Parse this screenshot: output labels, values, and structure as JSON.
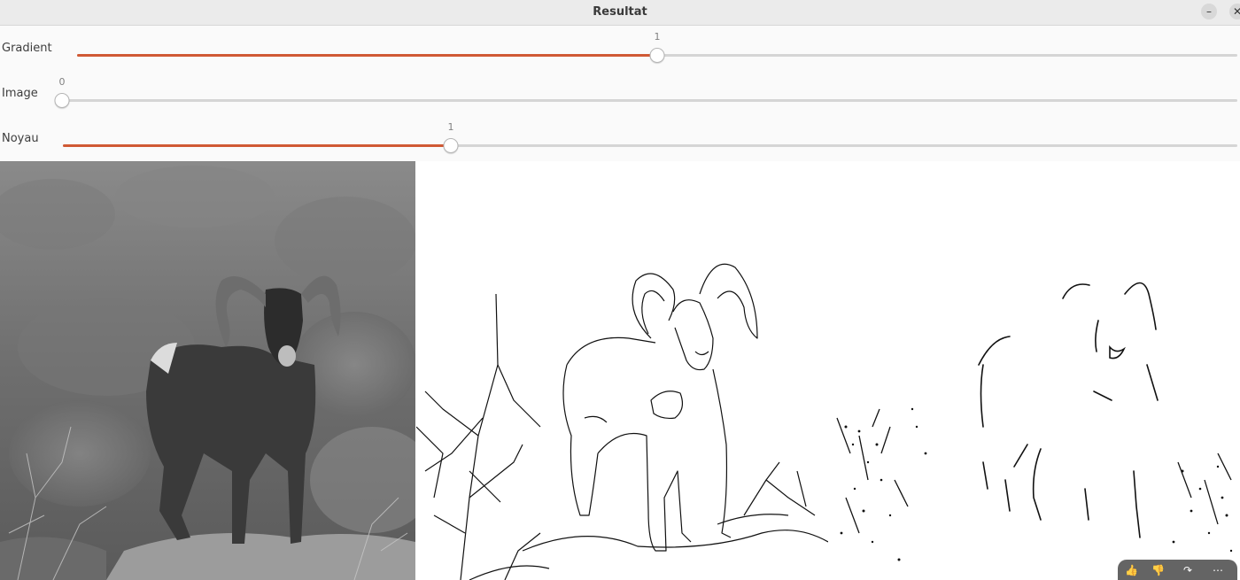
{
  "window": {
    "title": "Resultat"
  },
  "trackbars": [
    {
      "label": "Gradient",
      "value": "1",
      "fraction": 0.5
    },
    {
      "label": "Image",
      "value": "0",
      "fraction": 0.0
    },
    {
      "label": "Noyau",
      "value": "1",
      "fraction": 0.33
    }
  ],
  "icons": {
    "minimize": "minimize-icon",
    "close": "close-icon",
    "thumbs_up": "thumbs-up-icon",
    "thumbs_down": "thumbs-down-icon",
    "share": "share-icon",
    "more": "more-icon"
  },
  "colors": {
    "accent": "#d05934",
    "track": "#d5d5d5",
    "titlebar": "#ebebeb"
  }
}
